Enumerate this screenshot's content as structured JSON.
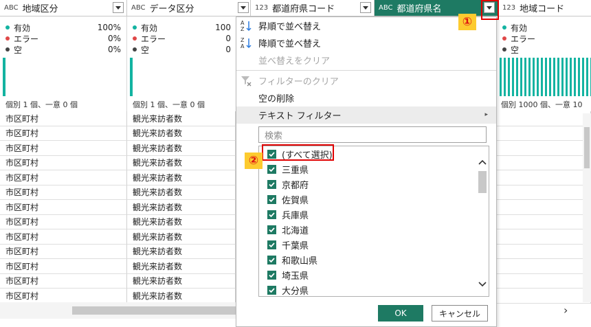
{
  "columns": [
    {
      "type": "ABC",
      "name": "地域区分"
    },
    {
      "type": "ABC",
      "name": "データ区分"
    },
    {
      "type": "123",
      "name": "都道府県コード"
    },
    {
      "type": "ABC",
      "name": "都道府県名"
    },
    {
      "type": "123",
      "name": "地域コード"
    }
  ],
  "quality": {
    "valid": "有効",
    "error": "エラー",
    "empty": "空",
    "col1": {
      "valid_pct": "100%",
      "error_pct": "0%",
      "empty_pct": "0%",
      "distinct": "個別 1 個、一意 0 個"
    },
    "col2": {
      "valid_pct": "100",
      "error_pct": "0",
      "empty_pct": "0",
      "distinct": "個別 1 個、一意 0 個"
    },
    "col5": {
      "distinct": "個別 1000 個、一意 10"
    }
  },
  "rows": {
    "col1": [
      "市区町村",
      "市区町村",
      "市区町村",
      "市区町村",
      "市区町村",
      "市区町村",
      "市区町村",
      "市区町村",
      "市区町村",
      "市区町村",
      "市区町村",
      "市区町村",
      "市区町村"
    ],
    "col2": [
      "観光来訪者数",
      "観光来訪者数",
      "観光来訪者数",
      "観光来訪者数",
      "観光来訪者数",
      "観光来訪者数",
      "観光来訪者数",
      "観光来訪者数",
      "観光来訪者数",
      "観光来訪者数",
      "観光来訪者数",
      "観光来訪者数",
      "観光来訪者数"
    ]
  },
  "menu": {
    "sort_asc": "昇順で並べ替え",
    "sort_desc": "降順で並べ替え",
    "clear_sort": "並べ替えをクリア",
    "clear_filter": "フィルターのクリア",
    "remove_empty": "空の削除",
    "text_filter": "テキスト フィルター",
    "search_placeholder": "検索",
    "items": [
      "(すべて選択)",
      "三重県",
      "京都府",
      "佐賀県",
      "兵庫県",
      "北海道",
      "千葉県",
      "和歌山県",
      "埼玉県",
      "大分県"
    ],
    "ok": "OK",
    "cancel": "キャンセル"
  },
  "annotations": {
    "one": "①",
    "two": "②"
  },
  "colors": {
    "accent": "#1e7a63",
    "bar": "#13b3a1",
    "highlight": "#e00000",
    "badge": "#fdcb2f"
  }
}
